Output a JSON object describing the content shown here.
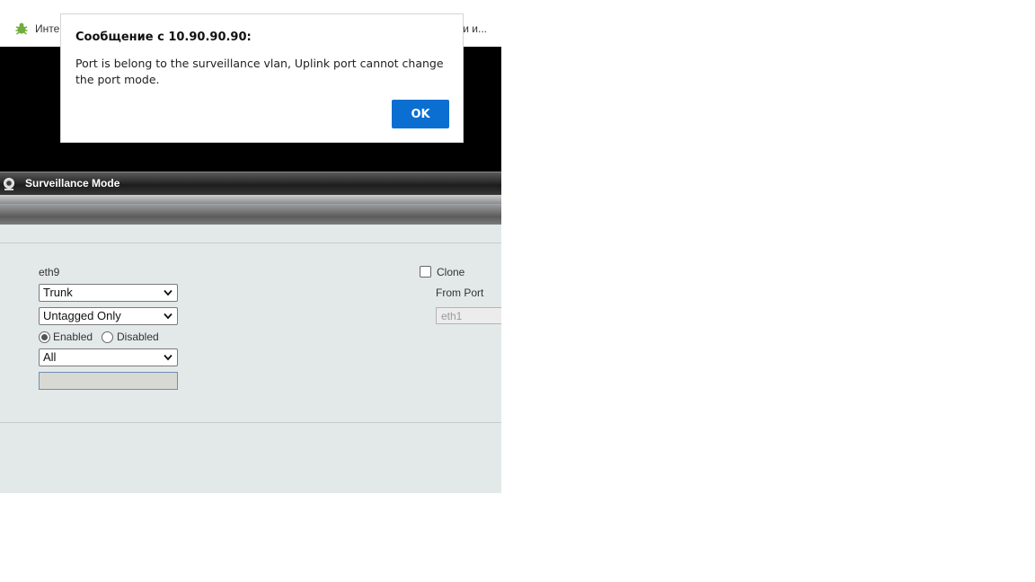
{
  "bookmarks": {
    "left_label": "Инте",
    "right_label": "ки и..."
  },
  "titlebar": {
    "title": "Surveillance Mode"
  },
  "form": {
    "port_label": "eth9",
    "mode_select": "Trunk",
    "tag_select": "Untagged Only",
    "radio_enabled": "Enabled",
    "radio_disabled": "Disabled",
    "radio_selected": "Enabled",
    "vlan_select": "All",
    "text_value": "",
    "clone_label": "Clone",
    "clone_checked": false,
    "from_port_label": "From Port",
    "from_port_value": "eth1"
  },
  "dialog": {
    "title": "Сообщение с 10.90.90.90:",
    "message": "Port is belong to the surveillance vlan, Uplink port cannot change the port mode.",
    "ok_label": "OK"
  },
  "colors": {
    "dialog_ok": "#0a6fd1",
    "content_bg": "#e3e9e9",
    "banner_bg": "#000000"
  }
}
